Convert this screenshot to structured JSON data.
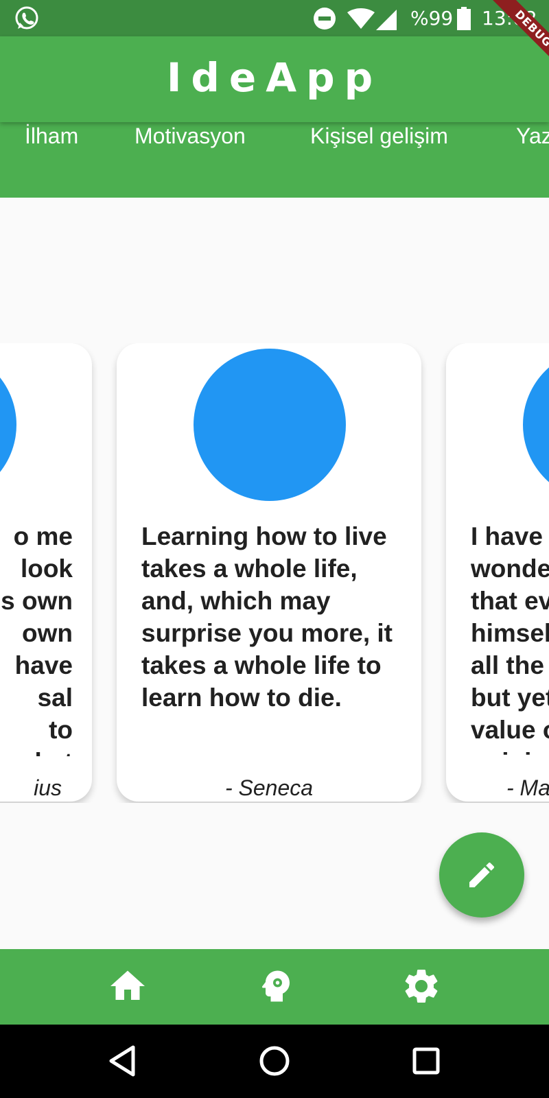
{
  "status_bar": {
    "battery_percent": "%99",
    "time": "13:02",
    "icons": [
      "whatsapp-icon",
      "do-not-disturb-icon",
      "wifi-icon",
      "cellular-signal-icon",
      "battery-icon"
    ]
  },
  "app_bar": {
    "title": "IdeApp",
    "debug_banner": "DEBUG"
  },
  "tabs": [
    {
      "label": "İlham"
    },
    {
      "label": "Motivasyon"
    },
    {
      "label": "Kişisel gelişim"
    },
    {
      "label": "Yaz"
    }
  ],
  "cards": {
    "left": {
      "quote": "o me\n look\ns own\n own\nhave\nsal\n to\nwhat",
      "author": "ius"
    },
    "center": {
      "quote": "Learning how to live takes a whole life, and, which may surprise you more, it takes a whole life to learn how to die.",
      "author": "- Seneca"
    },
    "right": {
      "quote": "I have\nwonde\nthat ev\nhimsel\nall the\nbut yet\nvalue o\nopinion",
      "author": "- Ma"
    }
  },
  "fab": {
    "icon": "pencil-icon"
  },
  "bottom_nav": {
    "items": [
      {
        "icon": "home-icon"
      },
      {
        "icon": "psychology-icon"
      },
      {
        "icon": "gear-icon"
      }
    ]
  },
  "system_nav": {
    "items": [
      {
        "icon": "back-triangle-icon"
      },
      {
        "icon": "home-circle-icon"
      },
      {
        "icon": "recents-square-icon"
      }
    ]
  },
  "colors": {
    "primary": "#4caf50",
    "status_bar": "#3c8c40",
    "avatar": "#2196f3",
    "background": "#fafafa",
    "debug_banner": "#8e1f1f"
  }
}
